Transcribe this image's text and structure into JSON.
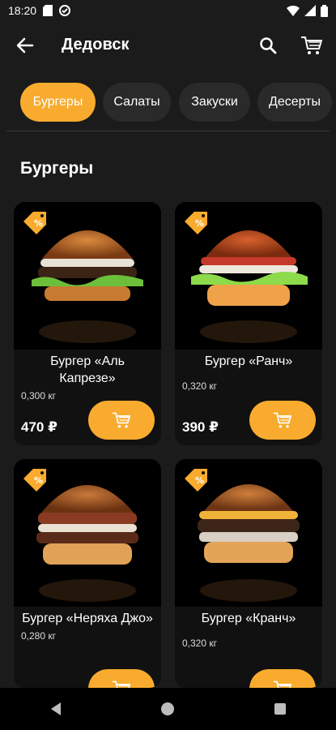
{
  "status_bar": {
    "time": "18:20"
  },
  "header": {
    "title": "Дедовск"
  },
  "tabs": [
    {
      "label": "Бургеры",
      "active": true
    },
    {
      "label": "Салаты",
      "active": false
    },
    {
      "label": "Закуски",
      "active": false
    },
    {
      "label": "Десерты",
      "active": false
    }
  ],
  "section": {
    "title": "Бургеры"
  },
  "products": [
    {
      "name": "Бургер «Аль Капрезе»",
      "weight": "0,300 кг",
      "price": "470 ₽",
      "discount": true
    },
    {
      "name": "Бургер «Ранч»",
      "weight": "0,320 кг",
      "price": "390 ₽",
      "discount": true
    },
    {
      "name": "Бургер «Неряха Джо»",
      "weight": "0,280 кг",
      "price": "",
      "discount": true
    },
    {
      "name": "Бургер «Кранч»",
      "weight": "0,320 кг",
      "price": "",
      "discount": true
    }
  ],
  "colors": {
    "accent": "#f8ab2e",
    "background": "#1b1b1b",
    "card": "#111111"
  },
  "icons": {
    "back": "arrow-left-icon",
    "search": "search-icon",
    "cart": "cart-icon",
    "add_to_cart": "cart-icon",
    "discount": "discount-tag-icon"
  }
}
